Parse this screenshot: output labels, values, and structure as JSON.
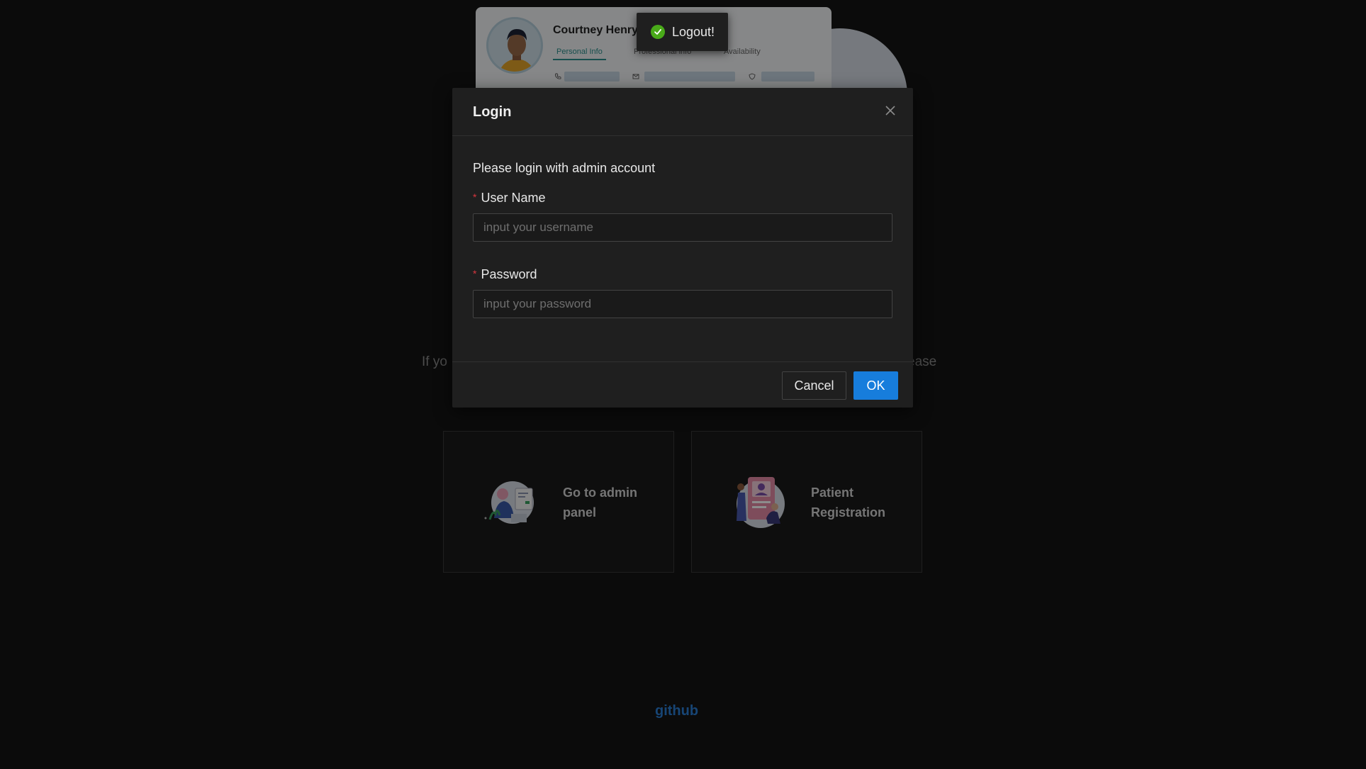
{
  "background": {
    "profile_card": {
      "name": "Courtney Henry",
      "tabs": [
        "Personal Info",
        "Professional info",
        "Availability"
      ],
      "info_icons": [
        "phone-icon",
        "mail-icon",
        "shield-icon"
      ]
    },
    "text_left_fragment": "If yo",
    "text_right_fragment": "ease",
    "cards": [
      {
        "label": "Go to admin panel",
        "icon": "admin-illustration"
      },
      {
        "label": "Patient Registration",
        "icon": "patient-registration-illustration"
      }
    ],
    "github_label": "github"
  },
  "toast": {
    "icon": "check-circle-icon",
    "text": "Logout!"
  },
  "modal": {
    "title": "Login",
    "description": "Please login with admin account",
    "username": {
      "label": "User Name",
      "value": "",
      "placeholder": "input your username"
    },
    "password": {
      "label": "Password",
      "value": "",
      "placeholder": "input your password"
    },
    "required_marker": "*",
    "cancel_label": "Cancel",
    "ok_label": "OK"
  },
  "colors": {
    "primary": "#177ddc",
    "success": "#49aa19",
    "required": "#d9363e",
    "link": "#2a7fd6",
    "background": "#141414"
  }
}
